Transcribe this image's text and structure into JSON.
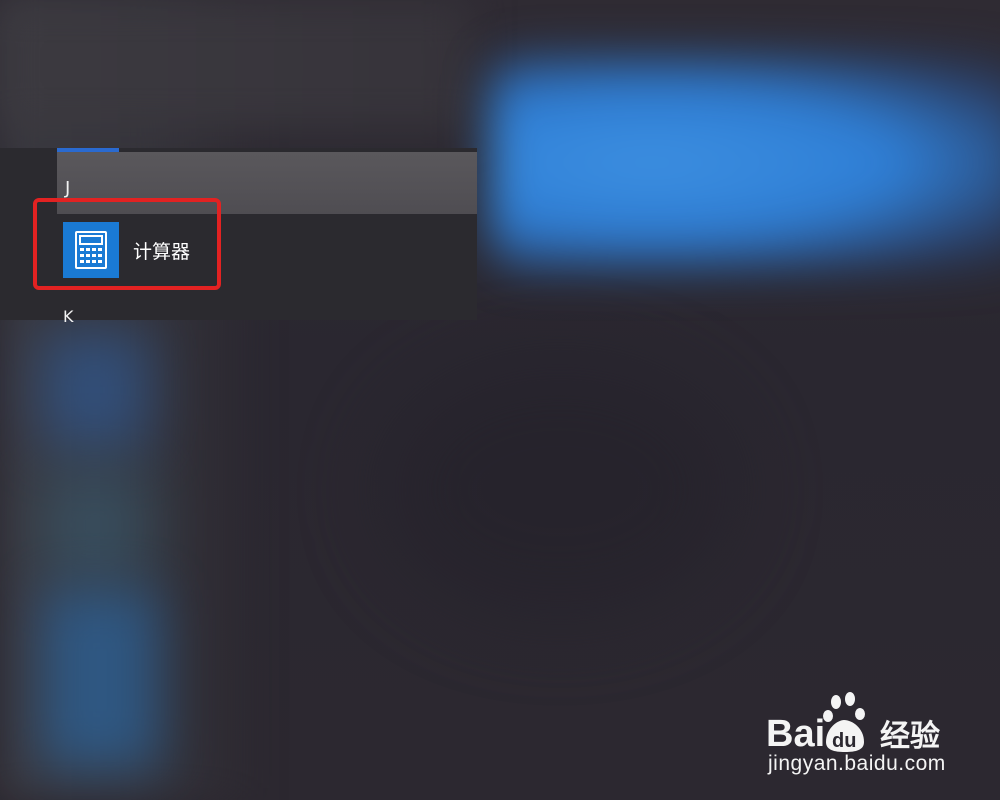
{
  "start_menu": {
    "group_letters": [
      "J",
      "K"
    ],
    "app": {
      "label": "计算器",
      "icon": "calculator-icon"
    }
  },
  "watermark": {
    "brand": "Baidu 经验",
    "url": "jingyan.baidu.com"
  },
  "colors": {
    "tile_blue": "#1a7ad4",
    "highlight_red": "#e22222",
    "accent_blue": "#2a6ad0"
  }
}
